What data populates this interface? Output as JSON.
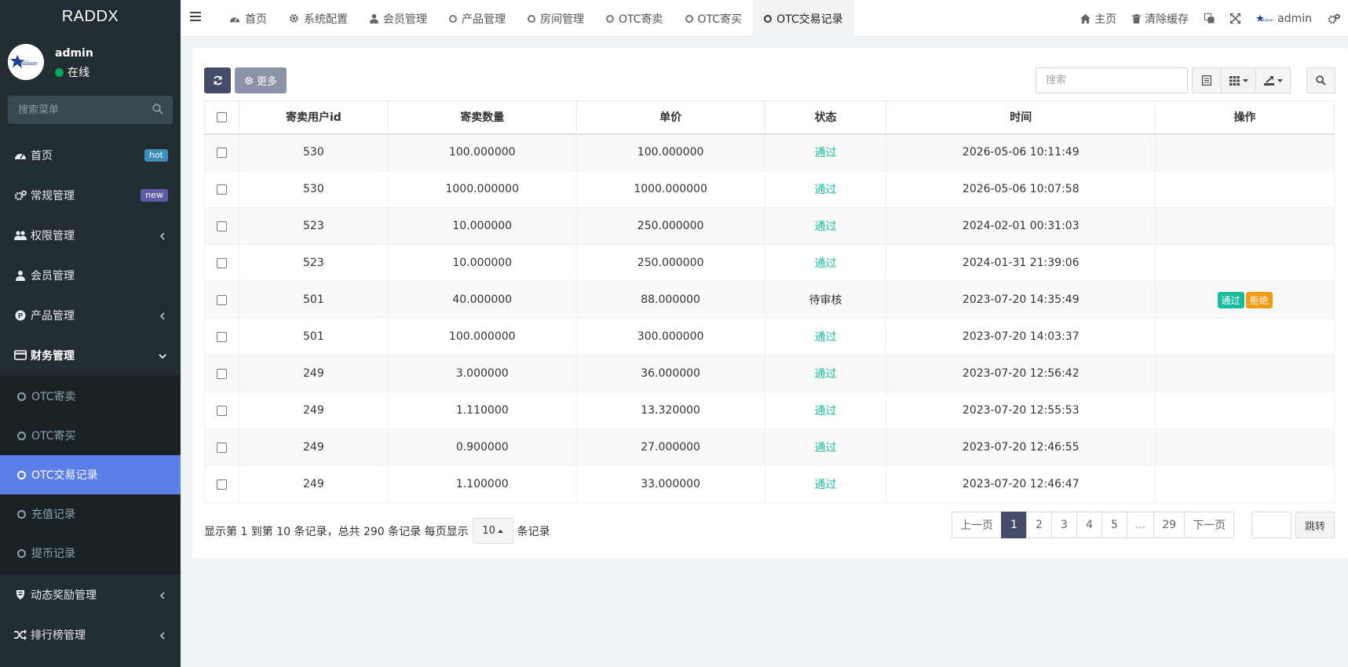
{
  "brand": "RADDX",
  "user": {
    "name": "admin",
    "status": "在线"
  },
  "sidebar": {
    "search_placeholder": "搜索菜单",
    "items": [
      {
        "label": "首页",
        "badge": "hot"
      },
      {
        "label": "常规管理",
        "badge": "new"
      },
      {
        "label": "权限管理"
      },
      {
        "label": "会员管理"
      },
      {
        "label": "产品管理"
      },
      {
        "label": "财务管理"
      }
    ],
    "finance_sub": [
      "OTC寄卖",
      "OTC寄买",
      "OTC交易记录",
      "充值记录",
      "提币记录"
    ],
    "bottom_items": [
      {
        "label": "动态奖励管理"
      },
      {
        "label": "排行榜管理"
      }
    ]
  },
  "topbar": {
    "tabs": [
      "首页",
      "系统配置",
      "会员管理",
      "产品管理",
      "房间管理",
      "OTC寄卖",
      "OTC寄买",
      "OTC交易记录"
    ],
    "right": {
      "home": "主页",
      "clear_cache": "清除缓存",
      "admin": "admin"
    }
  },
  "toolbar": {
    "more": "更多",
    "search_placeholder": "搜索"
  },
  "table": {
    "headers": [
      "寄卖用户id",
      "寄卖数量",
      "单价",
      "状态",
      "时间",
      "操作"
    ],
    "rows": [
      {
        "uid": "530",
        "qty": "100.000000",
        "price": "100.000000",
        "status": "通过",
        "time": "2026-05-06 10:11:49"
      },
      {
        "uid": "530",
        "qty": "1000.000000",
        "price": "1000.000000",
        "status": "通过",
        "time": "2026-05-06 10:07:58"
      },
      {
        "uid": "523",
        "qty": "10.000000",
        "price": "250.000000",
        "status": "通过",
        "time": "2024-02-01 00:31:03"
      },
      {
        "uid": "523",
        "qty": "10.000000",
        "price": "250.000000",
        "status": "通过",
        "time": "2024-01-31 21:39:06"
      },
      {
        "uid": "501",
        "qty": "40.000000",
        "price": "88.000000",
        "status": "待审核",
        "time": "2023-07-20 14:35:49",
        "actions": [
          "通过",
          "拒绝"
        ]
      },
      {
        "uid": "501",
        "qty": "100.000000",
        "price": "300.000000",
        "status": "通过",
        "time": "2023-07-20 14:03:37"
      },
      {
        "uid": "249",
        "qty": "3.000000",
        "price": "36.000000",
        "status": "通过",
        "time": "2023-07-20 12:56:42"
      },
      {
        "uid": "249",
        "qty": "1.110000",
        "price": "13.320000",
        "status": "通过",
        "time": "2023-07-20 12:55:53"
      },
      {
        "uid": "249",
        "qty": "0.900000",
        "price": "27.000000",
        "status": "通过",
        "time": "2023-07-20 12:46:55"
      },
      {
        "uid": "249",
        "qty": "1.100000",
        "price": "33.000000",
        "status": "通过",
        "time": "2023-07-20 12:46:47"
      }
    ]
  },
  "pagination": {
    "info": "显示第 1 到第 10 条记录，总共 290 条记录 每页显示",
    "page_size": "10",
    "suffix": "条记录",
    "prev": "上一页",
    "pages": [
      "1",
      "2",
      "3",
      "4",
      "5",
      "...",
      "29"
    ],
    "next": "下一页",
    "jump": "跳转"
  },
  "colors": {
    "sidebar_bg": "#222d32",
    "active_blue": "#5b7fe6",
    "pass_green": "#18bc9c",
    "warn_orange": "#f39c12",
    "dark_btn": "#444c69",
    "hot_badge": "#3c8dbc",
    "new_badge": "#605ca8"
  }
}
